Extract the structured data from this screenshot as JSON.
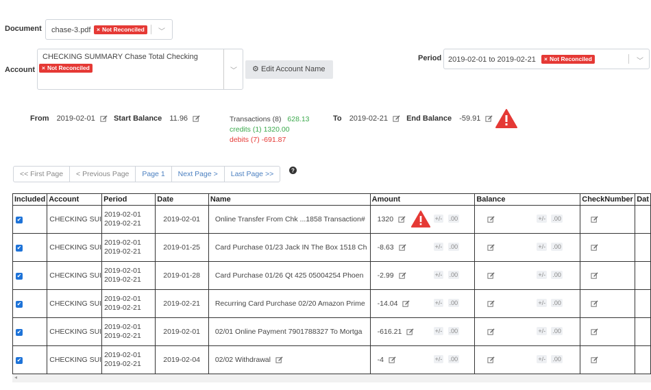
{
  "document": {
    "label": "Document",
    "value": "chase-3.pdf",
    "badge": "Not Reconciled"
  },
  "account": {
    "label": "Account",
    "value": "CHECKING SUMMARY Chase Total Checking",
    "badge": "Not Reconciled",
    "edit_button": "Edit Account Name"
  },
  "period": {
    "label": "Period",
    "value": "2019-02-01 to 2019-02-21",
    "badge": "Not Reconciled"
  },
  "summary": {
    "from_label": "From",
    "from_value": "2019-02-01",
    "start_balance_label": "Start Balance",
    "start_balance_value": "11.96",
    "transactions_label": "Transactions (8)",
    "transactions_value": "628.13",
    "credits": "credits (1) 1320.00",
    "debits": "debits (7) -691.87",
    "to_label": "To",
    "to_value": "2019-02-21",
    "end_balance_label": "End Balance",
    "end_balance_value": "-59.91"
  },
  "pager": {
    "first": "<< First Page",
    "prev": "< Previous Page",
    "page": "Page 1",
    "next": "Next Page >",
    "last": "Last Page >>"
  },
  "table": {
    "headers": [
      "Included",
      "Account",
      "Period",
      "Date",
      "Name",
      "Amount",
      "Balance",
      "CheckNumber",
      "Dat"
    ],
    "rows": [
      {
        "account": "CHECKING SUI",
        "period_start": "2019-02-01",
        "period_end": "2019-02-21",
        "date": "2019-02-01",
        "name": "Online Transfer From Chk ...1858 Transaction#",
        "amount": "1320"
      },
      {
        "account": "CHECKING SUI",
        "period_start": "2019-02-01",
        "period_end": "2019-02-21",
        "date": "2019-01-25",
        "name": "Card Purchase 01/23 Jack IN The Box 1518 Ch",
        "amount": "-8.63"
      },
      {
        "account": "CHECKING SUI",
        "period_start": "2019-02-01",
        "period_end": "2019-02-21",
        "date": "2019-01-28",
        "name": "Card Purchase 01/26 Qt 425 05004254 Phoen",
        "amount": "-2.99"
      },
      {
        "account": "CHECKING SUI",
        "period_start": "2019-02-01",
        "period_end": "2019-02-21",
        "date": "2019-02-21",
        "name": "Recurring Card Purchase 02/20 Amazon Prime",
        "amount": "-14.04"
      },
      {
        "account": "CHECKING SUI",
        "period_start": "2019-02-01",
        "period_end": "2019-02-21",
        "date": "2019-02-01",
        "name": "02/01 Online Payment 7901788327 To Mortga",
        "amount": "-616.21"
      },
      {
        "account": "CHECKING SUI",
        "period_start": "2019-02-01",
        "period_end": "2019-02-21",
        "date": "2019-02-04",
        "name": "02/02 Withdrawal",
        "amount": "-4"
      }
    ],
    "plus_minus": "+/-",
    "zero": ".00"
  }
}
